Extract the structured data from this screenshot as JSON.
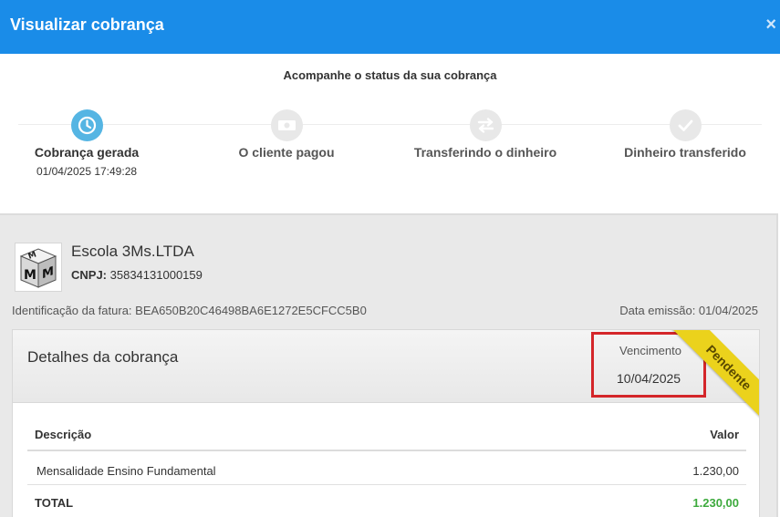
{
  "window": {
    "title": "Visualizar cobrança",
    "close_icon": "×"
  },
  "status": {
    "subtitle": "Acompanhe o status da sua cobrança",
    "steps": [
      {
        "label": "Cobrança gerada",
        "date": "01/04/2025 17:49:28",
        "icon": "clock-icon",
        "active": true
      },
      {
        "label": "O cliente pagou",
        "date": "",
        "icon": "money-icon",
        "active": false
      },
      {
        "label": "Transferindo o dinheiro",
        "date": "",
        "icon": "transfer-arrows-icon",
        "active": false
      },
      {
        "label": "Dinheiro transferido",
        "date": "",
        "icon": "checkmark-icon",
        "active": false
      }
    ]
  },
  "company": {
    "name": "Escola 3Ms.LTDA",
    "cnpj_label": "CNPJ:",
    "cnpj_value": "35834131000159",
    "logo_letters": "MMM"
  },
  "invoice": {
    "id_text": "Identificação da fatura: BEA650B20C46498BA6E1272E5CFCC5B0",
    "emission_text": "Data emissão: 01/04/2025"
  },
  "details": {
    "title": "Detalhes da cobrança",
    "due_label": "Vencimento",
    "due_date": "10/04/2025",
    "status_ribbon": "Pendente",
    "columns": {
      "description": "Descrição",
      "value": "Valor"
    },
    "items": [
      {
        "description": "Mensalidade Ensino Fundamental",
        "value": "1.230,00"
      }
    ],
    "total": {
      "label": "TOTAL",
      "value": "1.230,00"
    }
  },
  "colors": {
    "header": "#1a8ce8",
    "active_step": "#55b5e3",
    "inactive_step": "#e8e8e8",
    "highlight_box": "#d4262a",
    "ribbon": "#ebd21c",
    "total_value": "#3daa3d"
  }
}
